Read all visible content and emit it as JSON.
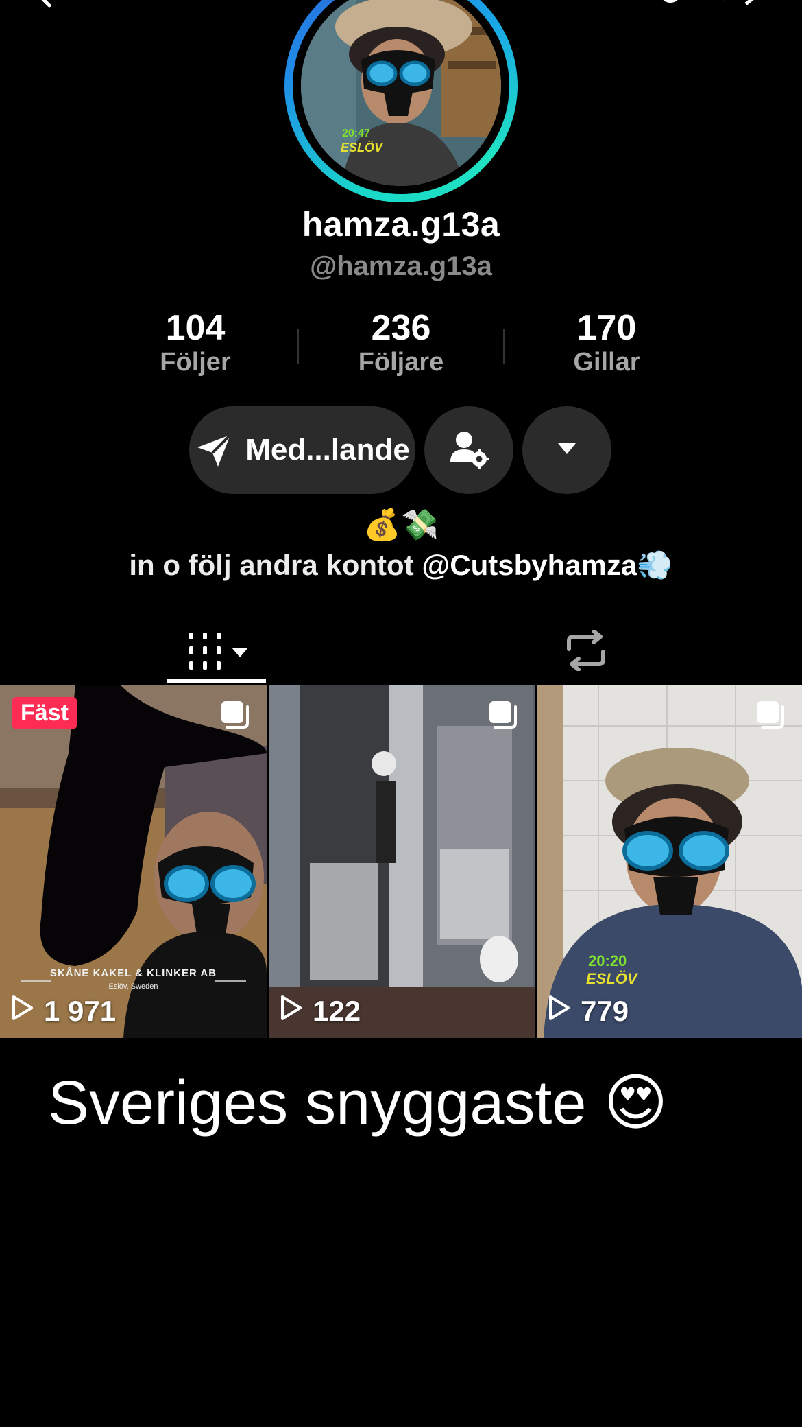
{
  "profile": {
    "display_name": "hamza.g13a",
    "handle": "@hamza.g13a"
  },
  "stats": [
    {
      "value": "104",
      "label": "Följer"
    },
    {
      "value": "236",
      "label": "Följare"
    },
    {
      "value": "170",
      "label": "Gillar"
    }
  ],
  "actions": {
    "message_label": "Med...lande"
  },
  "bio": {
    "emoji_line": "💰💸",
    "text": "in o följ andra kontot ",
    "mention": "@Cutsbyhamza",
    "trailing_emoji": "💨"
  },
  "tabs": {
    "videos_icon": "grid-columns-icon",
    "reposts_icon": "repost-icon"
  },
  "videos": [
    {
      "views": "1 971",
      "pinned_label": "Fäst",
      "overlay_title": "SKÅNE KAKEL & KLINKER AB",
      "overlay_subtitle": "Eslöv, Sweden"
    },
    {
      "views": "122"
    },
    {
      "views": "779",
      "overlay_time": "20:20",
      "overlay_place": "ESLÖV"
    }
  ],
  "avatar_overlay": {
    "time": "20:47",
    "place": "ESLÖV"
  },
  "caption": {
    "text": "Sveriges snyggaste ",
    "emoji": "😍"
  },
  "colors": {
    "background": "#000000",
    "button_bg": "#2b2b2b",
    "pinned_badge": "#fe2c55",
    "secondary_text": "#8a8a8a",
    "avatar_ring_start": "#19d8c9",
    "avatar_ring_end": "#1f8fe8"
  }
}
